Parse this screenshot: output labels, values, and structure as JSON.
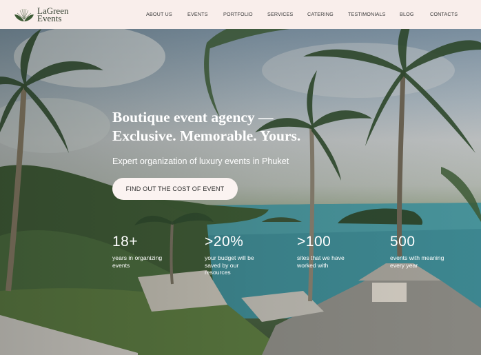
{
  "brand": {
    "line1": "LaGreen",
    "line2": "Events",
    "logo_icon": "lotus-leaf-icon",
    "color": "#2f3d2c"
  },
  "nav": {
    "items": [
      {
        "label": "ABOUT US"
      },
      {
        "label": "EVENTS"
      },
      {
        "label": "PORTFOLIO"
      },
      {
        "label": "SERVICES"
      },
      {
        "label": "CATERING"
      },
      {
        "label": "TESTIMONIALS"
      },
      {
        "label": "BLOG"
      },
      {
        "label": "CONTACTS"
      }
    ]
  },
  "hero": {
    "title_line1": "Boutique event agency —",
    "title_line2": "Exclusive. Memorable. Yours.",
    "subtitle": "Expert organization of luxury events in Phuket",
    "cta_label": "FIND OUT THE COST OF EVENT"
  },
  "stats": [
    {
      "value": "18+",
      "description": "years in organizing events"
    },
    {
      "value": ">20%",
      "description": "your budget will be saved by our resources"
    },
    {
      "value": ">100",
      "description": "sites that we have worked with"
    },
    {
      "value": "500",
      "description": "events with meaning every year"
    }
  ],
  "colors": {
    "header_bg": "#f9eeeb",
    "button_bg": "#fbf3f1",
    "text_on_hero": "#ffffff"
  }
}
